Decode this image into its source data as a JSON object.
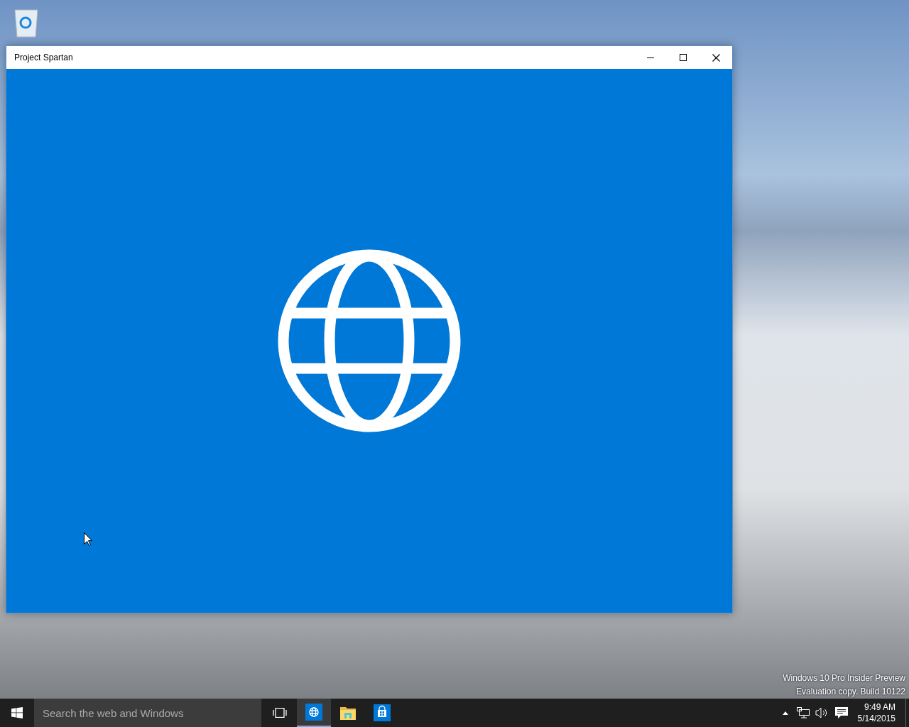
{
  "window": {
    "title": "Project Spartan"
  },
  "desktop_notice": [
    "Windows 10 Pro Insider Preview",
    "Evaluation copy. Build 10122"
  ],
  "taskbar": {
    "search": {
      "placeholder": "Search the web and Windows"
    },
    "apps": [
      {
        "kind": "browser",
        "selected": true
      },
      {
        "kind": "folder",
        "selected": false
      },
      {
        "kind": "store",
        "selected": false
      }
    ],
    "time": "9:49 AM",
    "date": "5/14/2015"
  }
}
